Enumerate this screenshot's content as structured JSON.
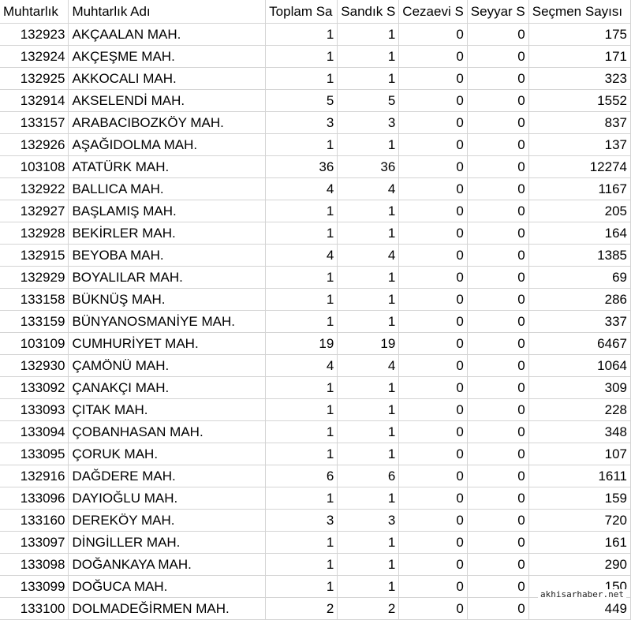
{
  "sheet": {
    "headers": [
      "Muhtarlık",
      "Muhtarlık Adı",
      "Toplam Sa",
      "Sandık S",
      "Cezaevi S",
      "Seyyar S",
      "Seçmen Sayısı"
    ],
    "rows": [
      [
        "132923",
        "AKÇAALAN MAH.",
        "1",
        "1",
        "0",
        "0",
        "175"
      ],
      [
        "132924",
        "AKÇEŞME MAH.",
        "1",
        "1",
        "0",
        "0",
        "171"
      ],
      [
        "132925",
        "AKKOCALI MAH.",
        "1",
        "1",
        "0",
        "0",
        "323"
      ],
      [
        "132914",
        "AKSELENDİ MAH.",
        "5",
        "5",
        "0",
        "0",
        "1552"
      ],
      [
        "133157",
        "ARABACIBOZKÖY MAH.",
        "3",
        "3",
        "0",
        "0",
        "837"
      ],
      [
        "132926",
        "AŞAĞIDOLMA MAH.",
        "1",
        "1",
        "0",
        "0",
        "137"
      ],
      [
        "103108",
        "ATATÜRK MAH.",
        "36",
        "36",
        "0",
        "0",
        "12274"
      ],
      [
        "132922",
        "BALLICA MAH.",
        "4",
        "4",
        "0",
        "0",
        "1167"
      ],
      [
        "132927",
        "BAŞLAMIŞ MAH.",
        "1",
        "1",
        "0",
        "0",
        "205"
      ],
      [
        "132928",
        "BEKİRLER MAH.",
        "1",
        "1",
        "0",
        "0",
        "164"
      ],
      [
        "132915",
        "BEYOBA MAH.",
        "4",
        "4",
        "0",
        "0",
        "1385"
      ],
      [
        "132929",
        "BOYALILAR MAH.",
        "1",
        "1",
        "0",
        "0",
        "69"
      ],
      [
        "133158",
        "BÜKNÜŞ MAH.",
        "1",
        "1",
        "0",
        "0",
        "286"
      ],
      [
        "133159",
        "BÜNYANOSMANİYE MAH.",
        "1",
        "1",
        "0",
        "0",
        "337"
      ],
      [
        "103109",
        "CUMHURİYET MAH.",
        "19",
        "19",
        "0",
        "0",
        "6467"
      ],
      [
        "132930",
        "ÇAMÖNÜ MAH.",
        "4",
        "4",
        "0",
        "0",
        "1064"
      ],
      [
        "133092",
        "ÇANAKÇI MAH.",
        "1",
        "1",
        "0",
        "0",
        "309"
      ],
      [
        "133093",
        "ÇITAK MAH.",
        "1",
        "1",
        "0",
        "0",
        "228"
      ],
      [
        "133094",
        "ÇOBANHASAN MAH.",
        "1",
        "1",
        "0",
        "0",
        "348"
      ],
      [
        "133095",
        "ÇORUK MAH.",
        "1",
        "1",
        "0",
        "0",
        "107"
      ],
      [
        "132916",
        "DAĞDERE MAH.",
        "6",
        "6",
        "0",
        "0",
        "1611"
      ],
      [
        "133096",
        "DAYIOĞLU MAH.",
        "1",
        "1",
        "0",
        "0",
        "159"
      ],
      [
        "133160",
        "DEREKÖY MAH.",
        "3",
        "3",
        "0",
        "0",
        "720"
      ],
      [
        "133097",
        "DİNGİLLER MAH.",
        "1",
        "1",
        "0",
        "0",
        "161"
      ],
      [
        "133098",
        "DOĞANKAYA MAH.",
        "1",
        "1",
        "0",
        "0",
        "290"
      ],
      [
        "133099",
        "DOĞUCA MAH.",
        "1",
        "1",
        "0",
        "0",
        "150"
      ],
      [
        "133100",
        "DOLMADEĞİRMEN MAH.",
        "2",
        "2",
        "0",
        "0",
        "449"
      ]
    ]
  },
  "watermark": "akhisarhaber.net"
}
